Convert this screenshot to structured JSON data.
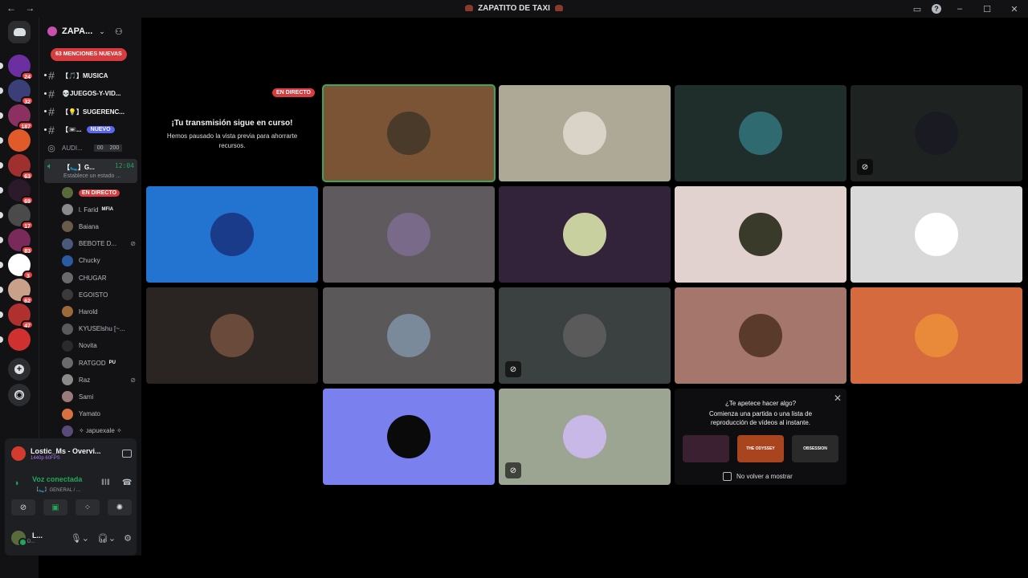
{
  "window": {
    "title": "ZAPATITO DE TAXI",
    "back": "←",
    "forward": "→"
  },
  "server": {
    "name": "ZAPA...",
    "mentions_label": "63 MENCIONES NUEVAS"
  },
  "servers": [
    {
      "badge": "24",
      "color": "#6b2fa0"
    },
    {
      "badge": "32",
      "color": "#3a3f77"
    },
    {
      "badge": "187",
      "color": "#8b3060"
    },
    {
      "badge": "",
      "color": "#e05a2a"
    },
    {
      "badge": "63",
      "color": "#a03030"
    },
    {
      "badge": "69",
      "color": "#2a1a2a"
    },
    {
      "badge": "17",
      "color": "#4a4a4a"
    },
    {
      "badge": "83",
      "color": "#7a2a5a"
    },
    {
      "badge": "3",
      "color": "#ffffff"
    },
    {
      "badge": "62",
      "color": "#c9a08a"
    },
    {
      "badge": "47",
      "color": "#b03030"
    },
    {
      "badge": "",
      "color": "#d03030"
    }
  ],
  "channels": [
    {
      "label": "【🎵】MUSICA"
    },
    {
      "label": "💀JUEGOS-Y-VID..."
    },
    {
      "label": "【💡】SUGERENC..."
    },
    {
      "label": "【📼...",
      "new": "NUEVO"
    }
  ],
  "audio_channel": {
    "label": "AUDI...",
    "count_a": "00",
    "count_b": "200"
  },
  "voice_channel": {
    "label": "【🥿】G...",
    "time": "12:04",
    "status": "Establece un estado ..."
  },
  "members": [
    {
      "name": "EN DIRECTO",
      "live": true,
      "color": "#5a6b3b"
    },
    {
      "name": "l. Farid",
      "tag": "MFIA",
      "color": "#8a8a8a"
    },
    {
      "name": "Baiana",
      "color": "#6a5a4a"
    },
    {
      "name": "BEBOTE D...",
      "muted": true,
      "color": "#4a5a7a"
    },
    {
      "name": "Chucky",
      "color": "#2a5aa0"
    },
    {
      "name": "CHUGAR",
      "color": "#6a6a6a"
    },
    {
      "name": "EGOISTO",
      "color": "#3a3a3a"
    },
    {
      "name": "Harold",
      "color": "#9a6a3a"
    },
    {
      "name": "KYUSElshu [~...",
      "color": "#5a5a5a"
    },
    {
      "name": "Novita",
      "color": "#2a2a2a"
    },
    {
      "name": "RATGOD",
      "tag": "PU",
      "color": "#6a6a6a"
    },
    {
      "name": "Raz",
      "muted": true,
      "color": "#8a8a8a"
    },
    {
      "name": "Sami",
      "color": "#9a7a7a"
    },
    {
      "name": "Yamato",
      "color": "#d87040"
    },
    {
      "name": "✧ ᴊapuexale ✧",
      "color": "#5a4a7a"
    }
  ],
  "panel": {
    "stream_title": "Lostic_Ms - Overvi...",
    "stream_quality": "1440p 60FPS",
    "voice_status": "Voz conectada",
    "voice_sub": "【🥿】GENERAL / ...",
    "user_name": "L...",
    "user_status": "D..."
  },
  "live_card": {
    "badge": "EN DIRECTO",
    "heading": "¡Tu transmisión sigue en curso!",
    "body": "Hemos pausado la vista previa para ahorrarte recursos."
  },
  "tiles": [
    {
      "bg": "#7a5434",
      "avatar": "#4a3a2a",
      "speaking": true
    },
    {
      "bg": "#aea896",
      "avatar": "#d9d3c8"
    },
    {
      "bg": "#1f2d2b",
      "avatar": "#2f6a70"
    },
    {
      "bg": "#1e2322",
      "avatar": "#1a1a22",
      "muted": true
    },
    {
      "bg": "#2373d0",
      "avatar": "#1a3a8a"
    },
    {
      "bg": "#5f5a5e",
      "avatar": "#7a6a8a"
    },
    {
      "bg": "#33233a",
      "avatar": "#c8d0a0"
    },
    {
      "bg": "#e2d2cf",
      "avatar": "#3a3a2a"
    },
    {
      "bg": "#dad9d9",
      "avatar": "#ffffff"
    },
    {
      "bg": "#2a2522",
      "avatar": "#6a4a3a"
    },
    {
      "bg": "#5a5858",
      "avatar": "#7a8a9a"
    },
    {
      "bg": "#3a4140",
      "avatar": "#5a5a5a",
      "muted": true
    },
    {
      "bg": "#a5776c",
      "avatar": "#5a3a2a"
    },
    {
      "bg": "#d66a3f",
      "avatar": "#e88a3a"
    },
    {
      "bg": "#7a80ee",
      "avatar": "#0a0a0a"
    },
    {
      "bg": "#9ba592",
      "avatar": "#c8b8e8",
      "muted": true
    }
  ],
  "activity": {
    "question": "¿Te apetece hacer algo?",
    "prompt": "Comienza una partida o una lista de reproducción de vídeos al instante.",
    "games": [
      {
        "label": "",
        "color": "#3a2030"
      },
      {
        "label": "THE ODYSSEY",
        "color": "#a8441e"
      },
      {
        "label": "OBSESSION",
        "color": "#2a2a2a"
      }
    ],
    "dont_show": "No volver a mostrar"
  }
}
